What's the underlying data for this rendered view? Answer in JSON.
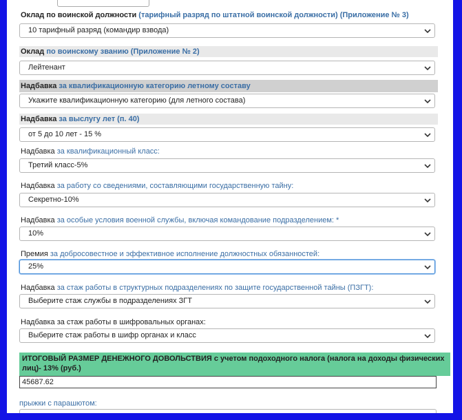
{
  "rows": [
    {
      "label_plain": "Оклад по воинской должности ",
      "label_link": "(тарифный разряд по штатной воинской должности) (Приложение № 3)",
      "value": "10 тарифный разряд (командир взвода)"
    },
    {
      "label_plain": "Оклад ",
      "label_link": "по воинскому званию (Приложение № 2)",
      "value": "Лейтенант"
    },
    {
      "label_plain": "Надбавка ",
      "label_link": "за квалификационную категорию летному составу",
      "value": "Укажите квалификационную категорию (для летного состава)"
    },
    {
      "label_plain": "Надбавка ",
      "label_link": "за выслугу лет (п. 40)",
      "value": "от 5 до 10 лет - 15 %"
    },
    {
      "label_plain": "Надбавка ",
      "label_link": "за квалификационный класс:",
      "value": "Третий класс-5%"
    },
    {
      "label_plain": "Надбавка ",
      "label_link": "за работу со сведениями, составляющими государственную тайну:",
      "value": "Секретно-10%"
    },
    {
      "label_plain": "Надбавка ",
      "label_link": "за особые условия военной службы, включая командование подразделением: *",
      "value": "10%"
    },
    {
      "label_plain": "Премия ",
      "label_link": "за добросовестное и эффективное исполнение должностных обязанностей:",
      "value": "25%"
    },
    {
      "label_plain": "Надбавка ",
      "label_link": "за стаж работы в структурных подразделениях по защите государственной тайны (ПЗГТ):",
      "value": "Выберите стаж службы в подразделениях ЗГТ"
    },
    {
      "label_plain": "Надбавка за стаж работы в шифровальных органах:",
      "label_link": "",
      "value": "Выберите стаж работы в шифр органах и класс"
    }
  ],
  "total": {
    "heading": "ИТОГОВЫЙ РАЗМЕР ДЕНЕЖНОГО ДОВОЛЬСТВИЯ с учетом подоходного налога (налога на доходы физических лиц)- 13% (руб.)",
    "value": "45687.62"
  },
  "last_label": "прыжки с парашютом:",
  "colors": {
    "frame_border": "#1414e6",
    "link": "#3a6ea5",
    "total_bg": "#66cc99"
  }
}
